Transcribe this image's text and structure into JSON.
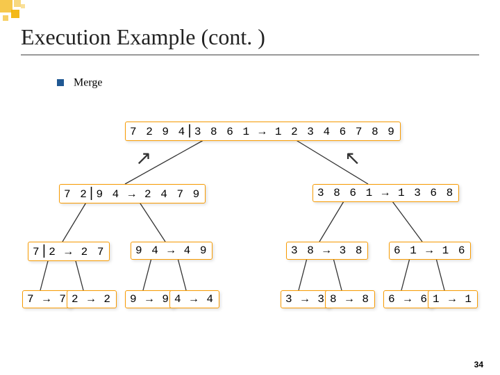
{
  "title": "Execution Example (cont. )",
  "bullet": "Merge",
  "pagenum": "34",
  "nodes": {
    "L0": "7 2 9 4⎮3 8 6 1 → 1 2 3 4 6 7 8 9",
    "L1a": "7 2⎮9 4 → 2 4 7 9",
    "L1b": "3 8 6 1 → 1 3 6 8",
    "L2a": "7⎮2 → 2 7",
    "L2b": "9 4 → 4 9",
    "L2c": "3 8 → 3 8",
    "L2d": "6 1 → 1 6",
    "L3a": "7 → 7",
    "L3b": "2 → 2",
    "L3c": "9 → 9",
    "L3d": "4 → 4",
    "L3e": "3 → 3",
    "L3f": "8 → 8",
    "L3g": "6 → 6",
    "L3h": "1 → 1"
  }
}
